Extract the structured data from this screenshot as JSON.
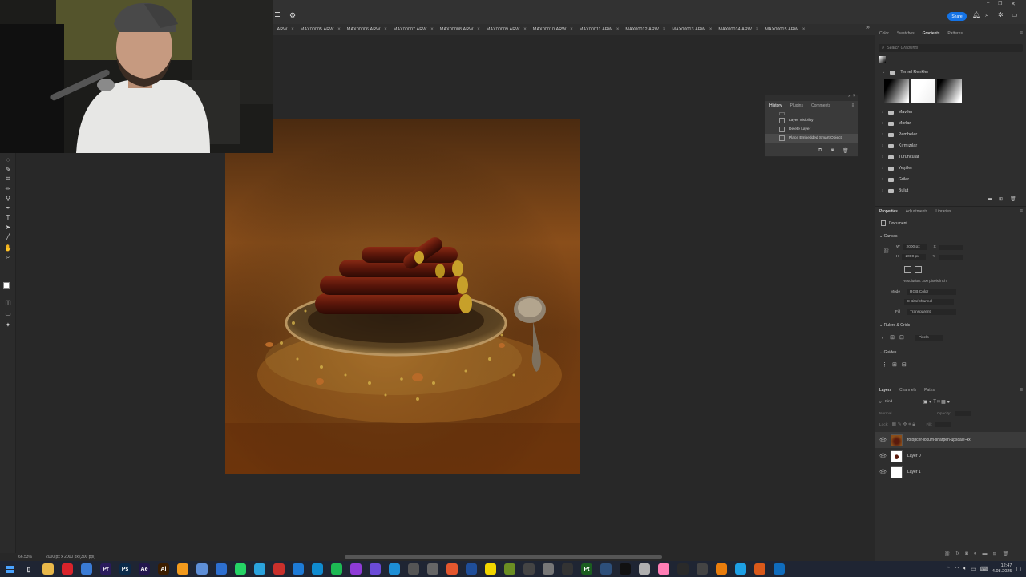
{
  "header": {
    "share_label": "Share"
  },
  "doc_tabs": [
    {
      "label": ".ARW"
    },
    {
      "label": "MAX00005.ARW"
    },
    {
      "label": "MAX00006.ARW"
    },
    {
      "label": "MAX00007.ARW"
    },
    {
      "label": "MAX00008.ARW"
    },
    {
      "label": "MAX00009.ARW"
    },
    {
      "label": "MAX00010.ARW"
    },
    {
      "label": "MAX00011.ARW"
    },
    {
      "label": "MAX00012.ARW"
    },
    {
      "label": "MAX00013.ARW"
    },
    {
      "label": "MAX00014.ARW"
    },
    {
      "label": "MAX00015.ARW"
    }
  ],
  "history_panel": {
    "tabs": [
      "History",
      "Plugins",
      "Comments"
    ],
    "items": [
      {
        "label": "Layer Visibility"
      },
      {
        "label": "Delete Layer"
      },
      {
        "label": "Place Embedded Smart Object"
      }
    ]
  },
  "gradients_panel": {
    "tabs": [
      "Color",
      "Swatches",
      "Gradients",
      "Patterns"
    ],
    "search_placeholder": "Search Gradients",
    "open_folder": "Temel Renkler",
    "folders": [
      "Maviler",
      "Morlar",
      "Pembeler",
      "Kırmızılar",
      "Turuncular",
      "Yeşiller",
      "Griler",
      "Bulut"
    ]
  },
  "properties_panel": {
    "tabs": [
      "Properties",
      "Adjustments",
      "Libraries"
    ],
    "doc_label": "Document",
    "canvas_header": "Canvas",
    "width_label": "W",
    "width_value": "2000 px",
    "height_label": "H",
    "height_value": "2000 px",
    "x_label": "X",
    "y_label": "Y",
    "resolution": "Resolution: 300 pixels/inch",
    "mode_label": "Mode",
    "mode_value": "RGB Color",
    "depth_value": "8 Bits/Channel",
    "fill_label": "Fill",
    "fill_value": "Transparent",
    "rulers_header": "Rulers & Grids",
    "rulers_unit": "Pixels",
    "guides_header": "Guides"
  },
  "layers_panel": {
    "tabs": [
      "Layers",
      "Channels",
      "Paths"
    ],
    "filter_kind": "Kind",
    "blend_mode": "Normal",
    "opacity_label": "Opacity:",
    "lock_label": "Lock:",
    "fill_label": "Fill:",
    "layers": [
      {
        "name": "fotopcer-lokum-sharpen-upscale-4x"
      },
      {
        "name": "Layer 0"
      },
      {
        "name": "Layer 1"
      }
    ]
  },
  "status_bar": {
    "zoom": "66.53%",
    "doc_info": "2000 px x 2000 px (300 ppi)"
  },
  "taskbar": {
    "time": "12:47",
    "date": "4.08.2025",
    "pinned_apps": [
      {
        "name": "file-explorer",
        "color": "#e8b84a"
      },
      {
        "name": "opera",
        "color": "#d9232b"
      },
      {
        "name": "chrome",
        "color": "#3a7bd5"
      },
      {
        "name": "premiere",
        "color": "#2a1b5c",
        "glyph": "Pr"
      },
      {
        "name": "photoshop",
        "color": "#0b2a4a",
        "glyph": "Ps"
      },
      {
        "name": "after-effects",
        "color": "#23164d",
        "glyph": "Ae"
      },
      {
        "name": "illustrator",
        "color": "#3b1d00",
        "glyph": "Ai"
      },
      {
        "name": "search-app",
        "color": "#f29a1d"
      },
      {
        "name": "cloud-app",
        "color": "#5e8fd8"
      },
      {
        "name": "browser",
        "color": "#2d6fd1"
      },
      {
        "name": "whatsapp",
        "color": "#25d366"
      },
      {
        "name": "telegram",
        "color": "#2aa3df"
      },
      {
        "name": "app-red",
        "color": "#c9302c"
      },
      {
        "name": "app-blue",
        "color": "#1d7bd8"
      },
      {
        "name": "app-teal",
        "color": "#0f8bd1"
      },
      {
        "name": "app-green",
        "color": "#1db954"
      },
      {
        "name": "app-purple",
        "color": "#8e3bd6"
      },
      {
        "name": "vpn-app",
        "color": "#6b4bd8"
      },
      {
        "name": "edge",
        "color": "#1d8fd6"
      },
      {
        "name": "app-gray",
        "color": "#555"
      },
      {
        "name": "app-settings",
        "color": "#666"
      },
      {
        "name": "app-orange",
        "color": "#e4572e"
      },
      {
        "name": "app-doc",
        "color": "#1f4e9a"
      },
      {
        "name": "sticky-notes",
        "color": "#f2d600"
      },
      {
        "name": "minecraft",
        "color": "#6b8e23"
      },
      {
        "name": "app-dark",
        "color": "#444"
      },
      {
        "name": "app-circle",
        "color": "#777"
      },
      {
        "name": "calendar",
        "color": "#333"
      },
      {
        "name": "painter",
        "color": "#1b5e20",
        "glyph": "Pt"
      },
      {
        "name": "app-img",
        "color": "#2d4f7a"
      },
      {
        "name": "capcut",
        "color": "#111"
      },
      {
        "name": "mail",
        "color": "#b0b0b0"
      },
      {
        "name": "app-pink",
        "color": "#ff7eb6"
      },
      {
        "name": "app-black",
        "color": "#2a2a2a"
      },
      {
        "name": "app-outline",
        "color": "#444"
      },
      {
        "name": "blender",
        "color": "#e87d0d"
      },
      {
        "name": "canva",
        "color": "#1da0e6"
      },
      {
        "name": "app-orange2",
        "color": "#d9591a"
      },
      {
        "name": "app-outlook",
        "color": "#0f6cbd"
      }
    ]
  }
}
